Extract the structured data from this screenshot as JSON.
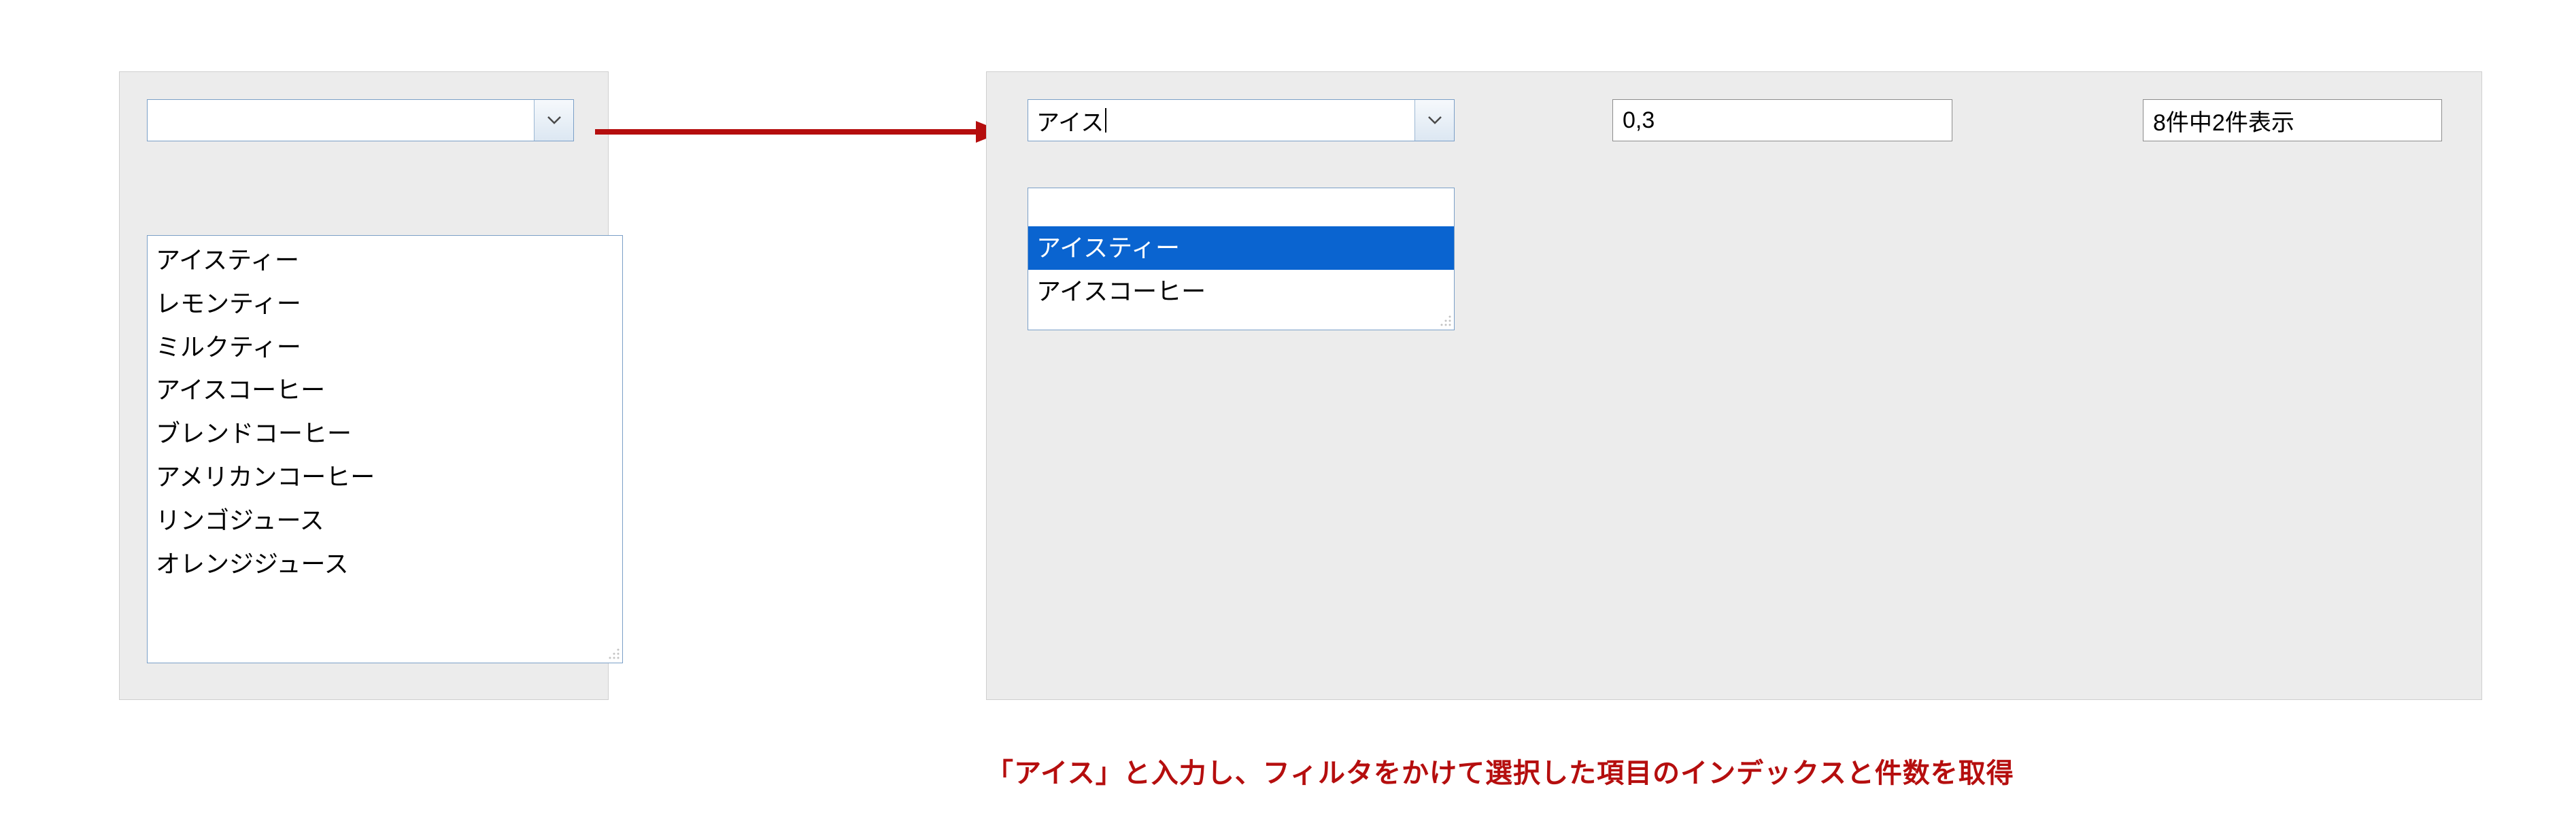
{
  "left": {
    "combo_value": "",
    "list_items": [
      "アイスティー",
      "レモンティー",
      "ミルクティー",
      "アイスコーヒー",
      "ブレンドコーヒー",
      "アメリカンコーヒー",
      "リンゴジュース",
      "オレンジジュース"
    ]
  },
  "right": {
    "combo_value": "アイス",
    "index_value": "0,3",
    "status_value": "8件中2件表示",
    "list_items": {
      "empty": "",
      "selected": "アイスティー",
      "other": "アイスコーヒー"
    }
  },
  "caption": "「アイス」と入力し、フィルタをかけて選択した項目のインデックスと件数を取得"
}
